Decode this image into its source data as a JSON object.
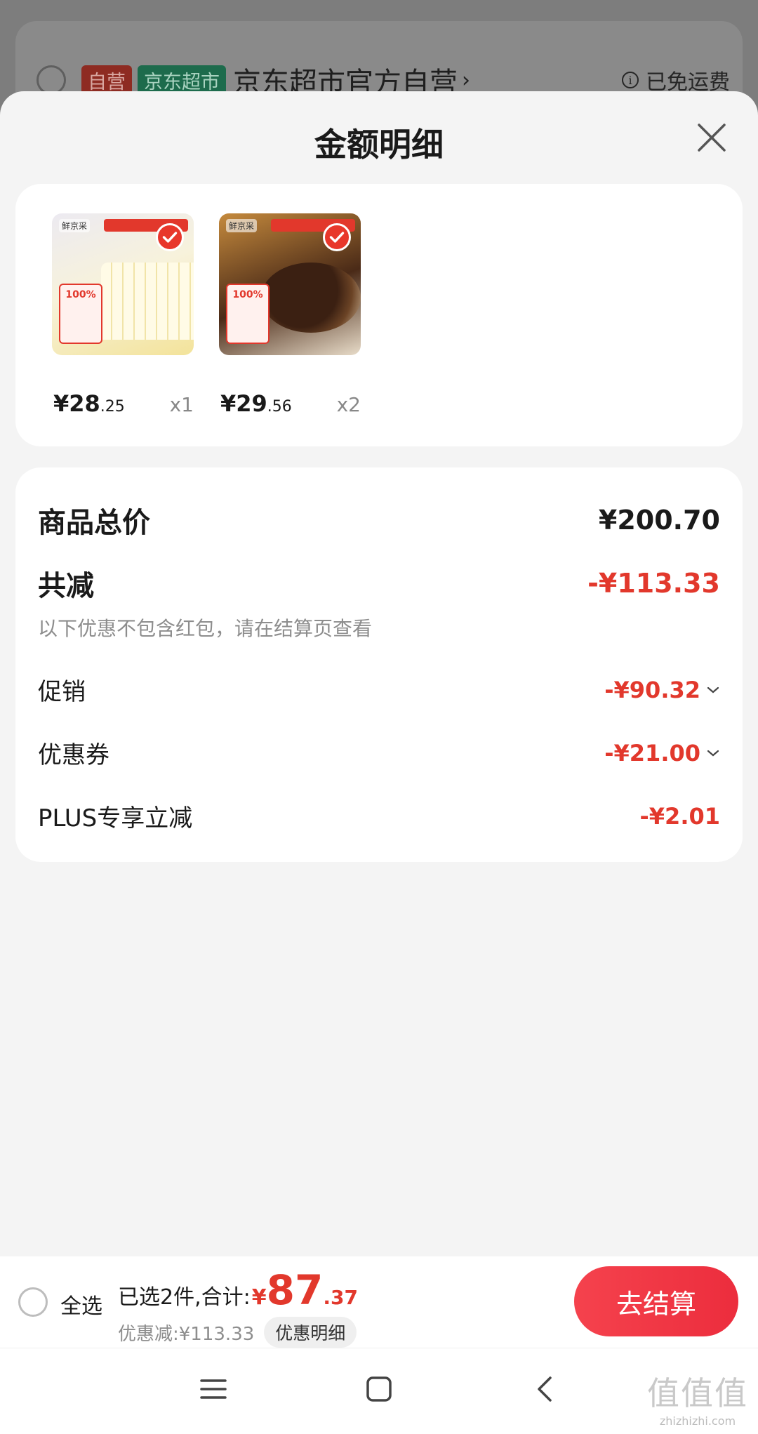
{
  "background": {
    "tag_self": "自营",
    "tag_market": "京东超市",
    "store_name": "京东超市官方自营",
    "store_chevron": "›",
    "shipping_info_icon": "i",
    "shipping_text": "已免运费"
  },
  "sheet": {
    "title": "金额明细"
  },
  "products": [
    {
      "image": "vanilla-cake",
      "price_int": "¥28",
      "price_dec": ".25",
      "qty": "x1",
      "badge": "100%",
      "logo": "鲜京采"
    },
    {
      "image": "chocolate-cake",
      "price_int": "¥29",
      "price_dec": ".56",
      "qty": "x2",
      "badge": "100%",
      "logo": "鲜京采"
    }
  ],
  "detail": {
    "total_label": "商品总价",
    "total_value": "¥200.70",
    "reduce_label": "共减",
    "reduce_value": "-¥113.33",
    "note": "以下优惠不包含红包，请在结算页查看",
    "promo_label": "促销",
    "promo_value": "-¥90.32",
    "coupon_label": "优惠券",
    "coupon_value": "-¥21.00",
    "plus_label": "PLUS专享立减",
    "plus_value": "-¥2.01"
  },
  "bottom": {
    "select_all": "全选",
    "summary_prefix": "已选2件,合计:",
    "currency": "¥",
    "amount_int": "87",
    "amount_dec": ".37",
    "discount_text": "优惠减:¥113.33",
    "detail_chip": "优惠明细",
    "checkout": "去结算"
  },
  "watermark": {
    "glyphs": "值值值",
    "url": "zhizhizhi.com"
  },
  "colors": {
    "accent_red": "#e2382c",
    "checkout_gradient_start": "#f5424d",
    "sheet_bg": "#f4f4f4"
  },
  "icons": {
    "close": "close-icon",
    "check": "check-icon",
    "chevron_down": "chevron-down-icon",
    "nav_menu": "menu-icon",
    "nav_home": "home-icon",
    "nav_back": "back-icon"
  }
}
